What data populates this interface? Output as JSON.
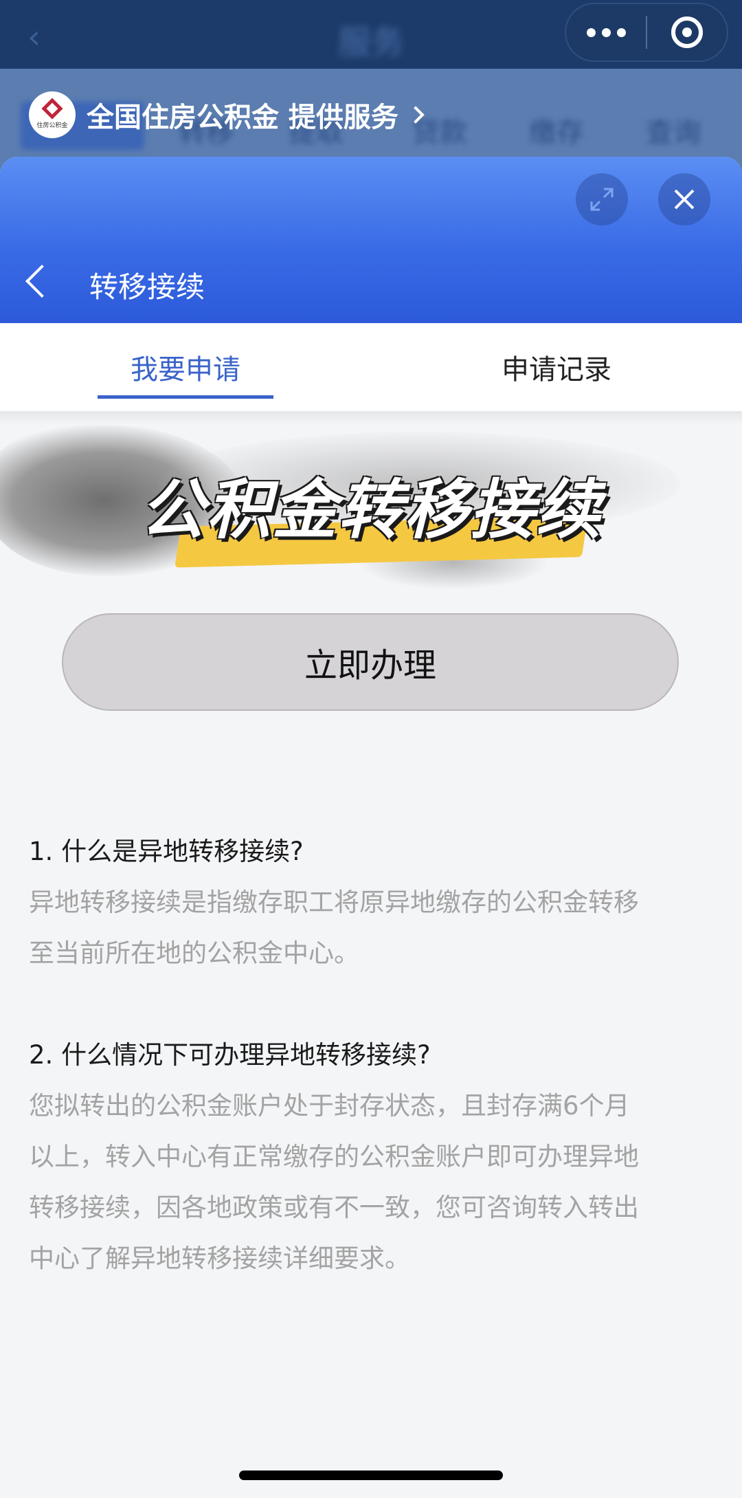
{
  "background": {
    "title": "服务",
    "chips": [
      "公积金",
      "转移",
      "提取",
      "贷款",
      "缴存",
      "查询"
    ]
  },
  "provider": {
    "logo_text": "住房公积金",
    "label": "全国住房公积金 提供服务"
  },
  "sheet": {
    "title": "转移接续"
  },
  "tabs": [
    {
      "label": "我要申请",
      "active": true
    },
    {
      "label": "申请记录",
      "active": false
    }
  ],
  "banner": {
    "title": "公积金转移接续"
  },
  "apply_button": "立即办理",
  "faq": [
    {
      "question": "1. 什么是异地转移接续?",
      "answer_lines": [
        "异地转移接续是指缴存职工将原异地缴存的公积金转移",
        "至当前所在地的公积金中心。"
      ]
    },
    {
      "question": "2. 什么情况下可办理异地转移接续?",
      "answer_lines": [
        "您拟转出的公积金账户处于封存状态，且封存满6个月",
        "以上，转入中心有正常缴存的公积金账户即可办理异地",
        "转移接续，因各地政策或有不一致，您可咨询转入转出",
        "中心了解异地转移接续详细要求。"
      ]
    }
  ],
  "colors": {
    "accent": "#3a63c9",
    "header_top": "#5b8ef3",
    "header_bottom": "#2c5ad9",
    "highlight": "#f5c842",
    "answer_text": "#a3a3a3"
  },
  "icons": {
    "capsule_more": "more-dots-icon",
    "capsule_close": "miniapp-close-icon",
    "expand": "expand-icon",
    "close": "close-icon",
    "back": "chevron-left-icon",
    "provider_chevron": "chevron-right-icon"
  }
}
